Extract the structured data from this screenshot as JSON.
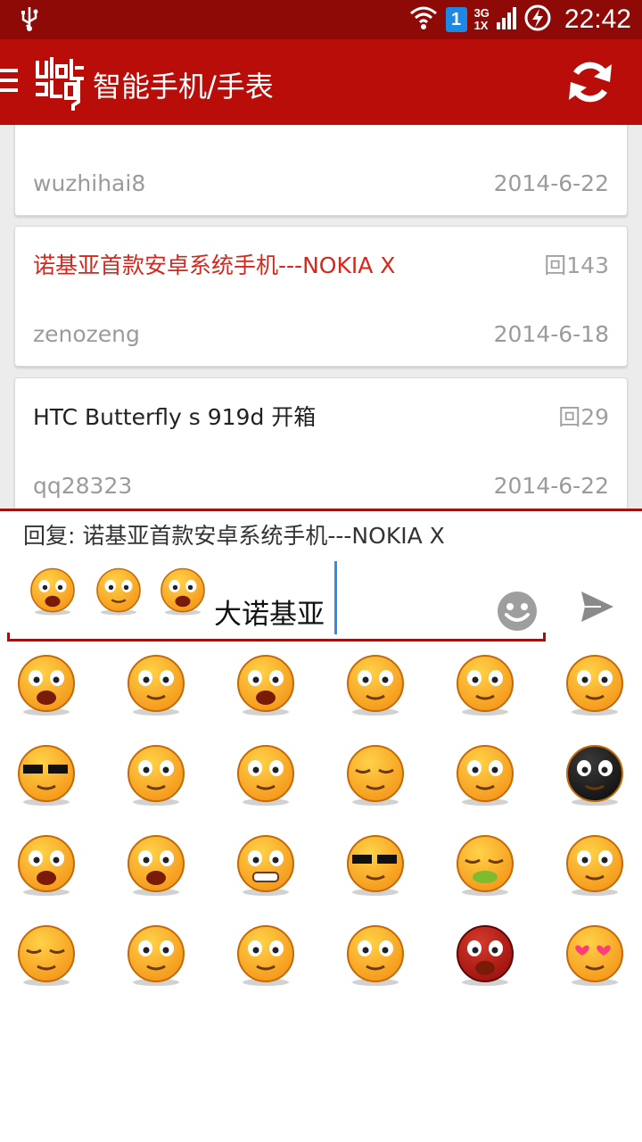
{
  "status_bar": {
    "time": "22:42",
    "sim_label": "1",
    "network_top": "3G",
    "network_bottom": "1X",
    "icons": [
      "usb-icon",
      "wifi-icon",
      "sim-icon",
      "signal-icon",
      "battery-charging-icon"
    ]
  },
  "app_bar": {
    "title": "智能手机/手表",
    "logo_text": "论坛",
    "menu_icon": "hamburger-icon",
    "refresh_icon": "refresh-icon"
  },
  "threads": [
    {
      "title": "",
      "replies": "",
      "author": "wuzhihai8",
      "date": "2014-6-22",
      "hot": false
    },
    {
      "title": "诺基亚首款安卓系统手机---NOKIA X",
      "replies": "回143",
      "author": "zenozeng",
      "date": "2014-6-18",
      "hot": true
    },
    {
      "title": "HTC Butterfly s 919d 开箱",
      "replies": "回29",
      "author": "qq28323",
      "date": "2014-6-22",
      "hot": false
    }
  ],
  "reply": {
    "reply_to": "回复: 诺基亚首款安卓系统手机---NOKIA X",
    "typed_text": "大诺基亚",
    "inserted_emoji": [
      "crying-face-emoji",
      "nervous-face-emoji",
      "shocked-face-emoji"
    ]
  },
  "emoji_panel": {
    "emoji": [
      "crying-face-emoji",
      "nervous-face-emoji",
      "shocked-face-emoji",
      "wink-tongue-emoji",
      "smug-blush-emoji",
      "teary-eyes-emoji",
      "afro-sunglasses-emoji",
      "frustrated-face-emoji",
      "fan-hide-emoji",
      "sleepy-face-emoji",
      "shy-thinking-emoji",
      "black-bomb-emoji",
      "loud-crying-emoji",
      "laughing-face-emoji",
      "grinning-teeth-emoji",
      "sunglasses-sweat-emoji",
      "sick-green-emoji",
      "dizzy-face-emoji",
      "tired-eyes-emoji",
      "angry-brows-emoji",
      "wincing-face-emoji",
      "pouty-face-emoji",
      "red-devil-emoji",
      "heart-eyes-emoji"
    ]
  },
  "colors": {
    "status_bar": "#8e0a07",
    "app_bar": "#b80d09",
    "hot_title": "#d9261c",
    "accent_line": "#9c1411",
    "cursor": "#2a8df0"
  }
}
